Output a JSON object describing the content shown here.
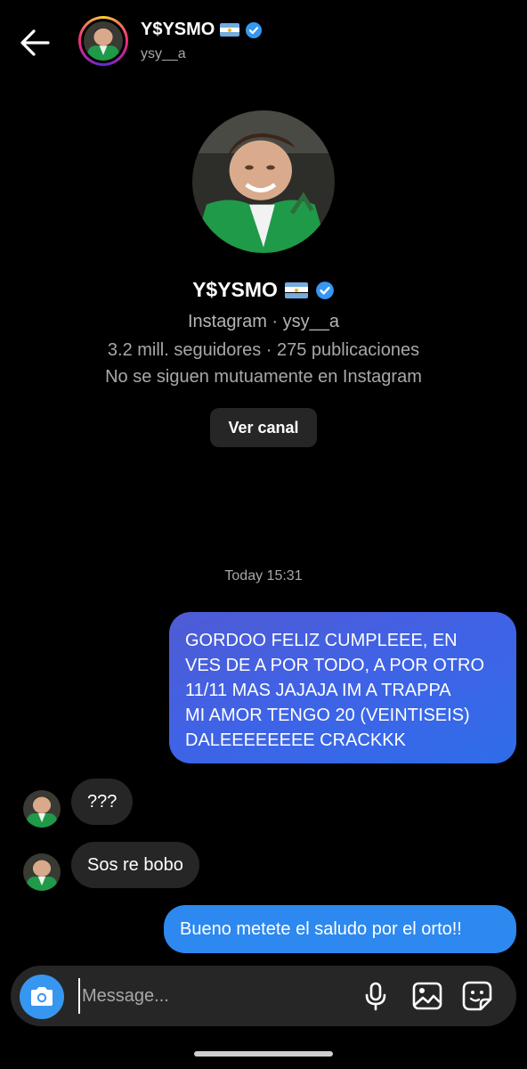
{
  "header": {
    "name": "Y$YSMO",
    "handle": "ysy__a",
    "back_icon": "arrow-left-icon",
    "verified_icon": "verified-badge-icon",
    "flag_icon": "argentina-flag-icon"
  },
  "profile": {
    "name": "Y$YSMO",
    "line1": "Instagram · ysy__a",
    "line2": "3.2 mill. seguidores · 275 publicaciones",
    "line3": "No se siguen mutuamente en Instagram",
    "button_label": "Ver canal"
  },
  "chat": {
    "timestamp": "Today 15:31",
    "messages": [
      {
        "from": "me",
        "text": "GORDOO FELIZ CUMPLEEE, EN\nVES DE A POR TODO, A POR OTRO\n11/11 MAS JAJAJA IM A TRAPPA\nMI AMOR TENGO 20 (VEINTISEIS)\nDALEEEEEEEE CRACKKK"
      },
      {
        "from": "them",
        "text": "???"
      },
      {
        "from": "them",
        "text": "Sos re bobo"
      },
      {
        "from": "me",
        "text": "Bueno metete el saludo por el orto!!"
      }
    ]
  },
  "composer": {
    "placeholder": "Message...",
    "icons": [
      "camera-icon",
      "microphone-icon",
      "gallery-icon",
      "sticker-icon"
    ]
  },
  "colors": {
    "accent": "#3797f0",
    "outgoing_bubble": "#3f63e6",
    "incoming_bubble": "#262626",
    "background": "#000000"
  }
}
